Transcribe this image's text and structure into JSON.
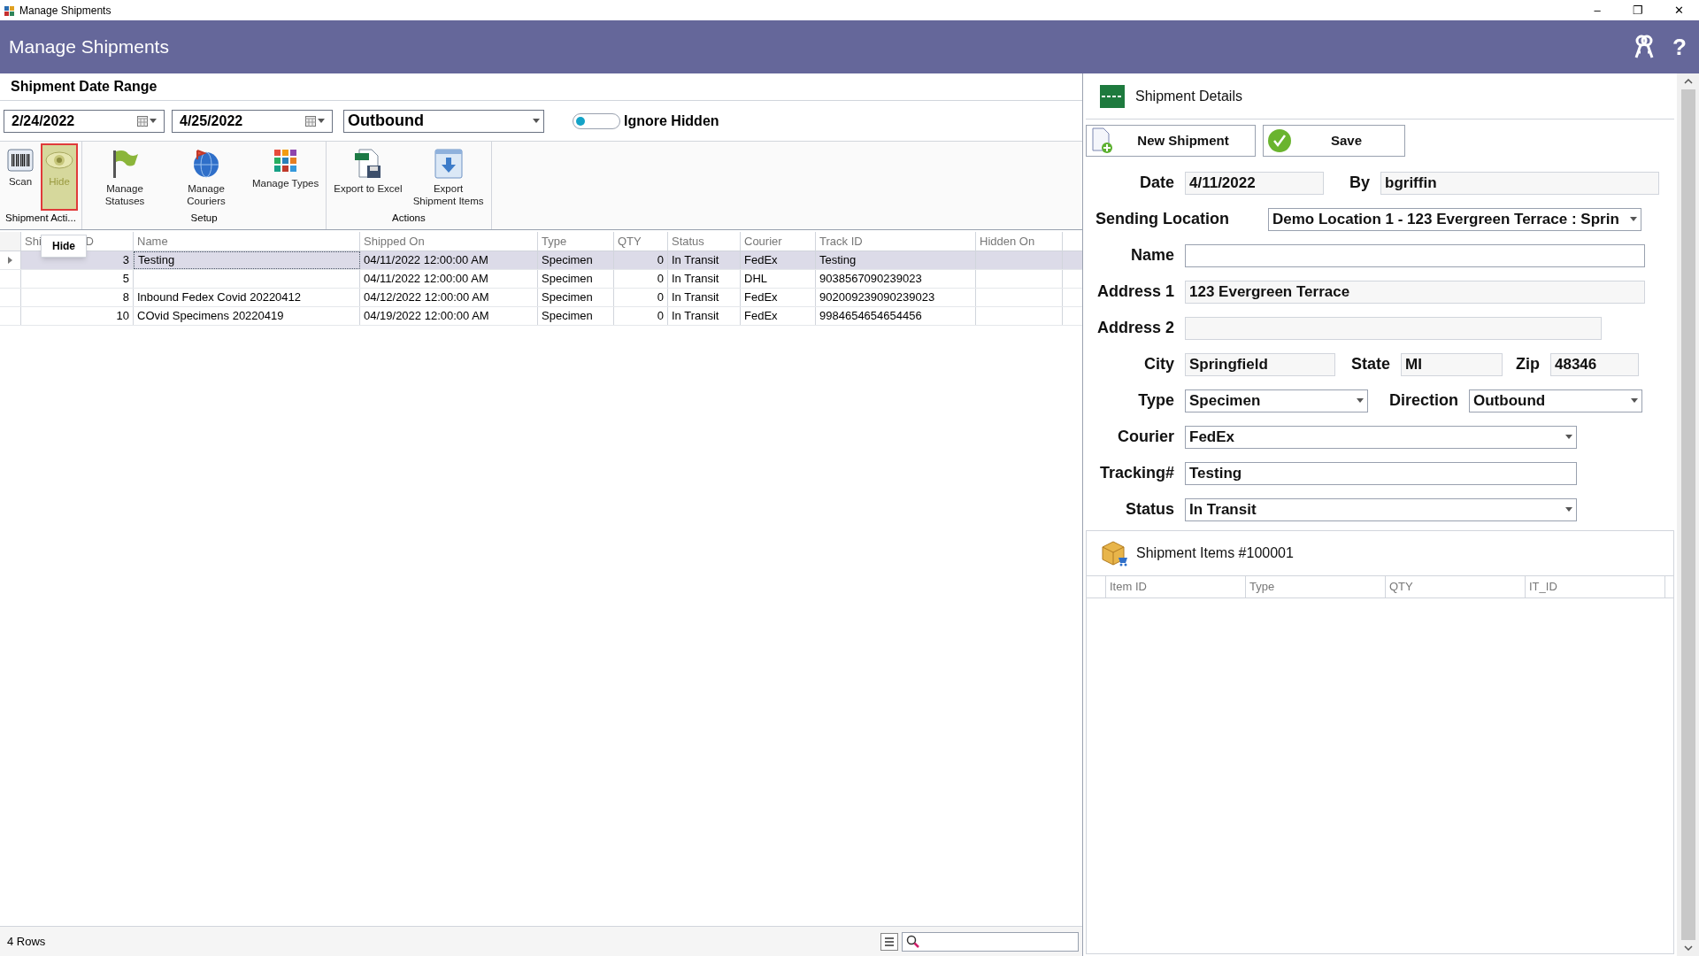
{
  "window": {
    "title": "Manage Shipments",
    "controls": [
      "–",
      "❐",
      "✕"
    ]
  },
  "header": {
    "title": "Manage Shipments",
    "help": "?"
  },
  "date_range": {
    "title": "Shipment Date Range",
    "start": "2/24/2022",
    "end": "4/25/2022",
    "direction": "Outbound",
    "ignore_hidden": {
      "label": "Ignore Hidden",
      "on": false
    }
  },
  "ribbon": {
    "groups": [
      {
        "label": "Shipment Acti...",
        "buttons": [
          {
            "kind": "scan",
            "label": "Scan",
            "selected": false
          },
          {
            "kind": "eye",
            "label": "Hide",
            "selected": true
          }
        ]
      },
      {
        "label": "Setup",
        "buttons": [
          {
            "kind": "flag",
            "label": "Manage Statuses",
            "selected": false
          },
          {
            "kind": "globe",
            "label": "Manage Couriers",
            "selected": false
          },
          {
            "kind": "grid",
            "label": "Manage Types",
            "selected": false
          }
        ]
      },
      {
        "label": "Actions",
        "buttons": [
          {
            "kind": "excel",
            "label": "Export to Excel",
            "selected": false
          },
          {
            "kind": "download",
            "label": "Export Shipment Items",
            "selected": false
          }
        ]
      }
    ]
  },
  "tooltip": "Hide",
  "table": {
    "columns": [
      {
        "label_start": "Shi",
        "label_end": "D"
      },
      {
        "label": "Name"
      },
      {
        "label": "Shipped On"
      },
      {
        "label": "Type"
      },
      {
        "label": "QTY"
      },
      {
        "label": "Status"
      },
      {
        "label": "Courier"
      },
      {
        "label": "Track ID"
      },
      {
        "label": "Hidden On"
      }
    ],
    "rows": [
      {
        "selected": true,
        "cells": [
          "3",
          "Testing",
          "04/11/2022 12:00:00 AM",
          "Specimen",
          "0",
          "In Transit",
          "FedEx",
          "Testing",
          ""
        ]
      },
      {
        "selected": false,
        "cells": [
          "5",
          "",
          "04/11/2022 12:00:00 AM",
          "Specimen",
          "0",
          "In Transit",
          "DHL",
          "9038567090239023",
          ""
        ]
      },
      {
        "selected": false,
        "cells": [
          "8",
          "Inbound Fedex Covid 20220412",
          "04/12/2022 12:00:00 AM",
          "Specimen",
          "0",
          "In Transit",
          "FedEx",
          "902009239090239023",
          ""
        ]
      },
      {
        "selected": false,
        "cells": [
          "10",
          "COvid Specimens 20220419",
          "04/19/2022 12:00:00 AM",
          "Specimen",
          "0",
          "In Transit",
          "FedEx",
          "9984654654654456",
          ""
        ]
      }
    ]
  },
  "status_bar": {
    "rows": "4 Rows"
  },
  "details": {
    "title": "Shipment Details",
    "new_button": "New Shipment",
    "save_button": "Save",
    "date_label": "Date",
    "date": "4/11/2022",
    "by_label": "By",
    "by": "bgriffin",
    "sending_location_label": "Sending Location",
    "sending_location": "Demo Location 1 - 123 Evergreen Terrace  : Sprin",
    "name_label": "Name",
    "address1_label": "Address 1",
    "address1": "123 Evergreen Terrace",
    "address2_label": "Address 2",
    "city_label": "City",
    "city": "Springfield",
    "state_label": "State",
    "state": "MI",
    "zip_label": "Zip",
    "zip": "48346",
    "type_label": "Type",
    "type": "Specimen",
    "direction_label": "Direction",
    "direction": "Outbound",
    "courier_label": "Courier",
    "courier": "FedEx",
    "tracking_label": "Tracking#",
    "tracking": "Testing",
    "status_label": "Status",
    "status": "In Transit"
  },
  "items": {
    "title": "Shipment Items #100001",
    "columns": [
      "Item ID",
      "Type",
      "QTY",
      "IT_ID"
    ]
  }
}
